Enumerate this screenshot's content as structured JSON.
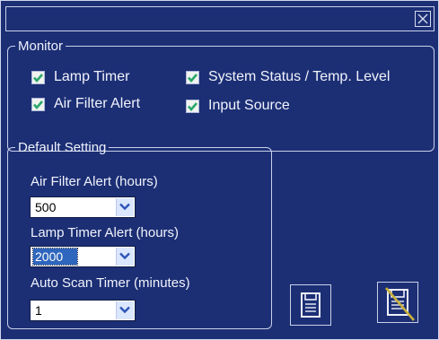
{
  "window": {
    "close_icon": "close-icon"
  },
  "monitor": {
    "legend": "Monitor",
    "items": [
      {
        "label": "Lamp Timer",
        "checked": true
      },
      {
        "label": "System Status / Temp. Level",
        "checked": true
      },
      {
        "label": "Air Filter Alert",
        "checked": true
      },
      {
        "label": "Input Source",
        "checked": true
      }
    ]
  },
  "default_setting": {
    "legend": "Default Setting",
    "air_filter": {
      "label": "Air Filter Alert (hours)",
      "value": "500"
    },
    "lamp_timer": {
      "label": "Lamp Timer Alert (hours)",
      "value": "2000"
    },
    "auto_scan": {
      "label": "Auto Scan Timer (minutes)",
      "value": "1"
    }
  },
  "buttons": {
    "save_icon": "save-icon",
    "no_save_icon": "no-save-icon"
  },
  "colors": {
    "background": "#1c2f75",
    "check": "#2aa86a",
    "accent": "#c9b13a",
    "selection": "#2e66bd"
  }
}
